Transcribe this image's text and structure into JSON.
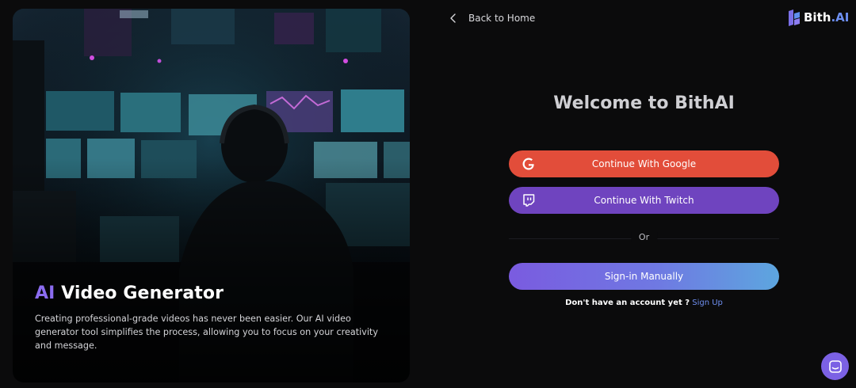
{
  "nav": {
    "back_label": "Back to Home"
  },
  "brand": {
    "name": "Bith",
    "suffix": ".AI",
    "color": "#6d8ff2"
  },
  "hero": {
    "title_accent": "AI",
    "title_rest": " Video Generator",
    "description": "Creating professional-grade videos has never been easier. Our AI video generator tool simplifies the process, allowing you to focus on your creativity and message."
  },
  "auth": {
    "welcome": "Welcome to BithAI",
    "google_label": "Continue With Google",
    "twitch_label": "Continue With Twitch",
    "or_label": "Or",
    "manual_label": "Sign-in Manually",
    "no_account_text": "Don't have an account yet ?",
    "signup_link": "Sign Up"
  },
  "colors": {
    "google": "#e24d3a",
    "twitch": "#6f44bf",
    "accent": "#8b6cf0",
    "background": "#0b0b0c"
  },
  "icons": {
    "back": "chevron-left-icon",
    "google": "google-icon",
    "twitch": "twitch-icon",
    "chat": "chat-icon",
    "brand": "bith-logo-icon"
  }
}
